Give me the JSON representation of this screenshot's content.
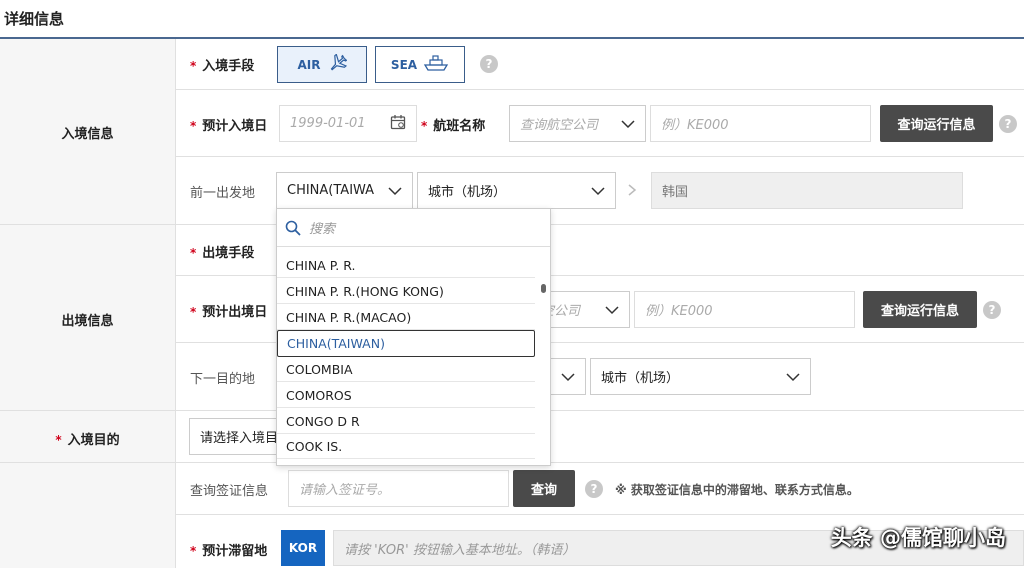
{
  "page": {
    "title": "详细信息"
  },
  "entry": {
    "section_label": "入境信息",
    "means_label": "入境手段",
    "air_label": "AIR",
    "sea_label": "SEA",
    "date_label": "预计入境日",
    "date_placeholder": "1999-01-01",
    "flight_label": "航班名称",
    "airline_placeholder": "查询航空公司",
    "flight_placeholder": "例）KE000",
    "query_btn": "查询运行信息",
    "departure_label": "前一出发地",
    "country_value": "CHINA(TAIWA",
    "city_placeholder": "城市（机场）",
    "destination_value": "韩国"
  },
  "dropdown": {
    "search_placeholder": "搜索",
    "items": [
      "CHINA P. R.",
      "CHINA P. R.(HONG KONG)",
      "CHINA P. R.(MACAO)",
      "CHINA(TAIWAN)",
      "COLOMBIA",
      "COMOROS",
      "CONGO D R",
      "COOK IS."
    ],
    "selected": "CHINA(TAIWAN)"
  },
  "exit": {
    "section_label": "出境信息",
    "means_label": "出境手段",
    "date_label": "预计出境日",
    "airline_placeholder_partial": "空公司",
    "flight_placeholder": "例）KE000",
    "query_btn": "查询运行信息",
    "next_label": "下一目的地",
    "city_placeholder": "城市（机场）"
  },
  "purpose": {
    "label": "入境目的",
    "select_placeholder": "请选择入境目"
  },
  "visa": {
    "label": "查询签证信息",
    "input_placeholder": "请输入签证号。",
    "query_btn": "查询",
    "note": "※ 获取签证信息中的滞留地、联系方式信息。"
  },
  "stay": {
    "label": "预计滞留地",
    "kor_btn": "KOR",
    "address_placeholder": "请按 'KOR' 按钮输入基本地址。（韩语）"
  },
  "required_mark": "*",
  "help_mark": "?",
  "watermark": "头条 @儒馆聊小岛",
  "colors": {
    "accent": "#2d5fa0",
    "required": "#d0021b",
    "dark_button": "#4a4a4a",
    "kor_button": "#1565c0"
  }
}
